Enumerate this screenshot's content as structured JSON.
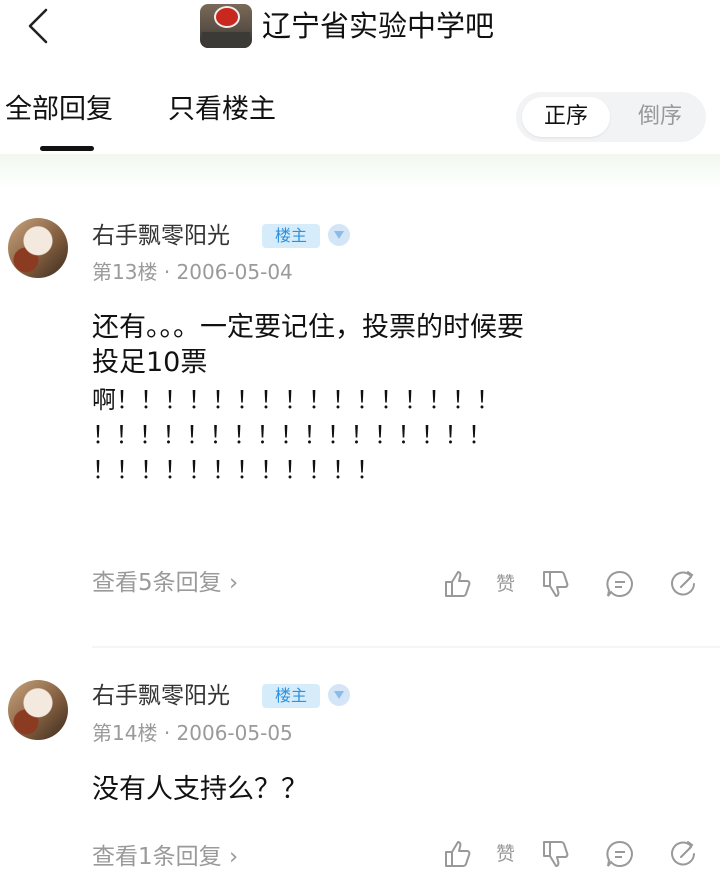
{
  "header": {
    "title": "辽宁省实验中学吧"
  },
  "tabs": {
    "all": "全部回复",
    "owner_only": "只看楼主",
    "sort_asc": "正序",
    "sort_desc": "倒序"
  },
  "posts": [
    {
      "author": "右手飘零阳光",
      "badge": "楼主",
      "floor": "第13楼",
      "date": "2006-05-04",
      "lines": [
        "还有。。。一定要记住，投票的时候要",
        "投足10票",
        "啊！！！！！！！！！！！！！！！！",
        "！！！！！！！！！！！！！！！！！",
        "！！！！！！！！！！！！"
      ],
      "view_replies": "查看5条回复",
      "like_label": "赞"
    },
    {
      "author": "右手飘零阳光",
      "badge": "楼主",
      "floor": "第14楼",
      "date": "2006-05-05",
      "lines": [
        "没有人支持么？？"
      ],
      "view_replies": "查看1条回复",
      "like_label": "赞"
    }
  ]
}
